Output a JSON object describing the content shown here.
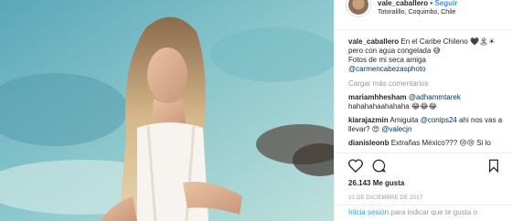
{
  "header": {
    "username": "vale_caballero",
    "separator": "•",
    "follow_label": "Seguir",
    "location": "Totoralillo, Coquimbo, Chile"
  },
  "caption": {
    "username": "vale_caballero",
    "line1": "En el Caribe Chileno 🖤🏝☀",
    "line2": "pero con agua congelada 😅",
    "line3": "Fotos de mi seca amiga",
    "mention": "@carmencabezasphoto"
  },
  "load_more_label": "Cargar más comentarios",
  "comments": [
    {
      "user": "mariamhhesham",
      "mention": "@adhammtarek",
      "text": "hahahahaahahaha 😂😂😂"
    },
    {
      "user": "kiarajazmin",
      "text": "Amiguita",
      "mention": "@conips24",
      "text2": "ahi nos vas a llevar? 😍",
      "mention2": "@valecjn"
    },
    {
      "user": "dianisleonb",
      "text": "Extrañas México??? 😢😢 Si lo"
    }
  ],
  "actions": {
    "like_icon": "heart-icon",
    "comment_icon": "comment-icon",
    "save_icon": "bookmark-icon",
    "likes": "26.143 Me gusta",
    "date": "10 DE DICIEMBRE DE 2017"
  },
  "footer": {
    "login_label": "Inicia sesión",
    "rest": " para indicar que te gusta o"
  },
  "colors": {
    "link": "#3897f0",
    "muted": "#999999",
    "text": "#262626"
  }
}
